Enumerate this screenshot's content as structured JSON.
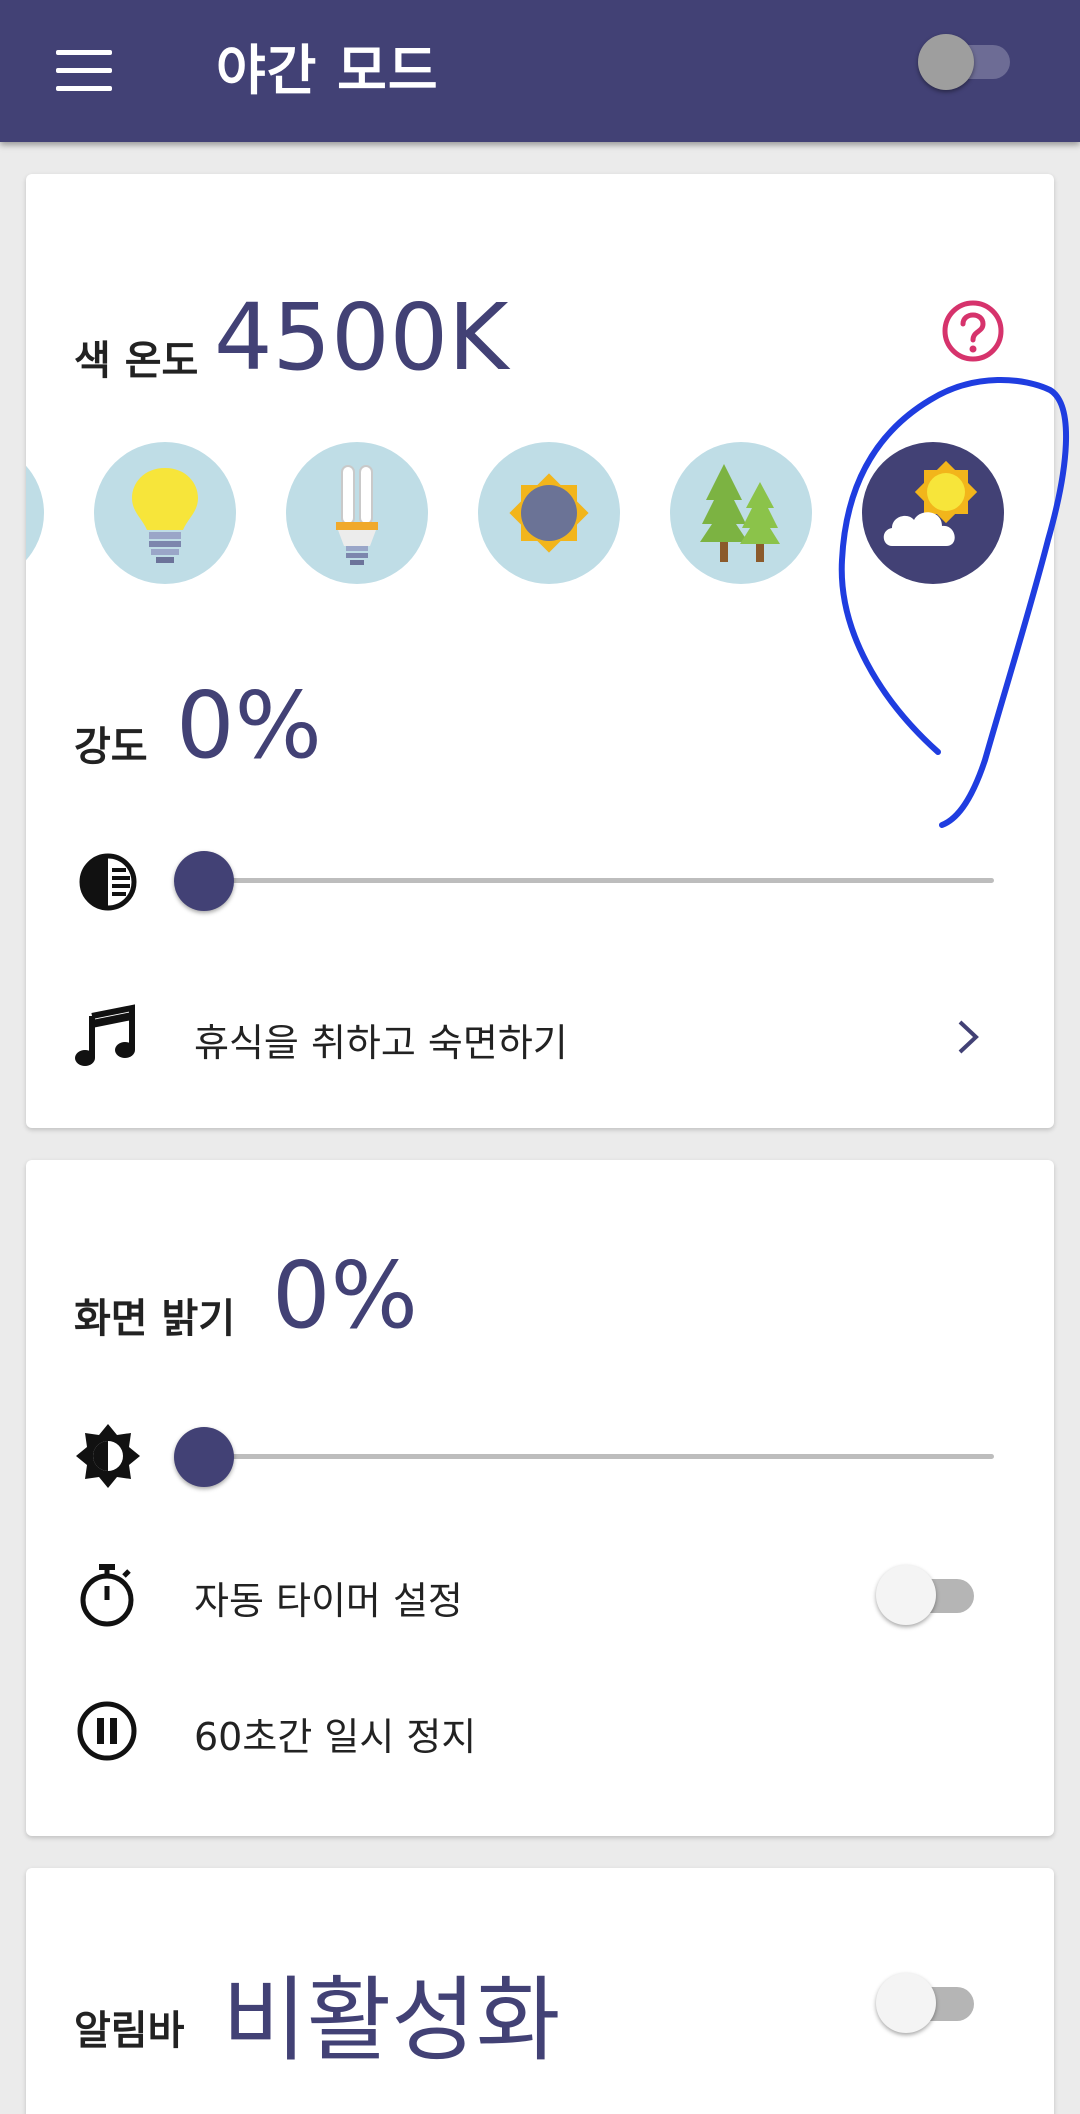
{
  "appbar": {
    "title": "야간 모드",
    "menu_icon": "hamburger-menu-icon",
    "master_switch_on": false
  },
  "color_temperature": {
    "label": "색 온도",
    "value": "4500K",
    "help_icon": "help-circle-icon",
    "presets": [
      {
        "name": "partial-preset",
        "icon": "unknown-icon"
      },
      {
        "name": "incandescent",
        "icon": "light-bulb-icon"
      },
      {
        "name": "fluorescent",
        "icon": "fluorescent-bulb-icon"
      },
      {
        "name": "sun",
        "icon": "sun-icon"
      },
      {
        "name": "forest",
        "icon": "trees-icon"
      },
      {
        "name": "cloudy-sun",
        "icon": "sun-cloud-icon",
        "selected": true
      }
    ]
  },
  "intensity": {
    "label": "강도",
    "value": "0%",
    "level": 0,
    "icon": "contrast-icon"
  },
  "sleep_row": {
    "label": "휴식을 취하고 숙면하기",
    "icon": "music-note-icon"
  },
  "screen_dim": {
    "label": "화면 밝기",
    "value": "0%",
    "level": 0,
    "icon": "brightness-icon"
  },
  "auto_timer": {
    "label": "자동 타이머 설정",
    "icon": "stopwatch-icon",
    "enabled": false
  },
  "pause_row": {
    "label": "60초간 일시 정지",
    "icon": "pause-circle-icon"
  },
  "notification_bar": {
    "label": "알림바",
    "value": "비활성화",
    "enabled": false
  },
  "colors": {
    "primary": "#424175",
    "help_accent": "#d6336c",
    "preset_background": "#bfdde6",
    "annotation_stroke": "#1f3de0"
  }
}
